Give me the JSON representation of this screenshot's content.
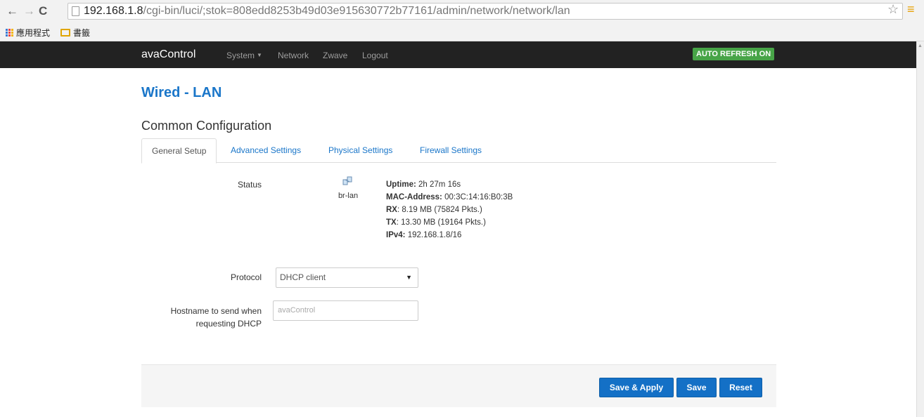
{
  "browser": {
    "url_host": "192.168.1.8",
    "url_path": "/cgi-bin/luci/;stok=808edd8253b49d03e915630772b77161/admin/network/network/lan",
    "bookmarks": [
      "應用程式",
      "書籤"
    ]
  },
  "navbar": {
    "brand": "avaControl",
    "items": [
      "System",
      "Network",
      "Zwave",
      "Logout"
    ],
    "auto_refresh": "AUTO REFRESH ON"
  },
  "page": {
    "title": "Wired - LAN",
    "section": "Common Configuration",
    "tabs": [
      "General Setup",
      "Advanced Settings",
      "Physical Settings",
      "Firewall Settings"
    ],
    "active_tab": "General Setup"
  },
  "status": {
    "label": "Status",
    "interface": "br-lan",
    "uptime_label": "Uptime:",
    "uptime": "2h 27m 16s",
    "mac_label": "MAC-Address:",
    "mac": "00:3C:14:16:B0:3B",
    "rx_label": "RX",
    "rx": ": 8.19 MB (75824 Pkts.)",
    "tx_label": "TX",
    "tx": ": 13.30 MB (19164 Pkts.)",
    "ipv4_label": "IPv4:",
    "ipv4": "192.168.1.8/16"
  },
  "form": {
    "protocol_label": "Protocol",
    "protocol_value": "DHCP client",
    "hostname_label_1": "Hostname to send when",
    "hostname_label_2": "requesting DHCP",
    "hostname_placeholder": "avaControl"
  },
  "actions": {
    "save_apply": "Save & Apply",
    "save": "Save",
    "reset": "Reset"
  },
  "colors": {
    "accent": "#1a76c9",
    "button": "#1470c6",
    "badge": "#47a447",
    "navbar": "#222222"
  }
}
